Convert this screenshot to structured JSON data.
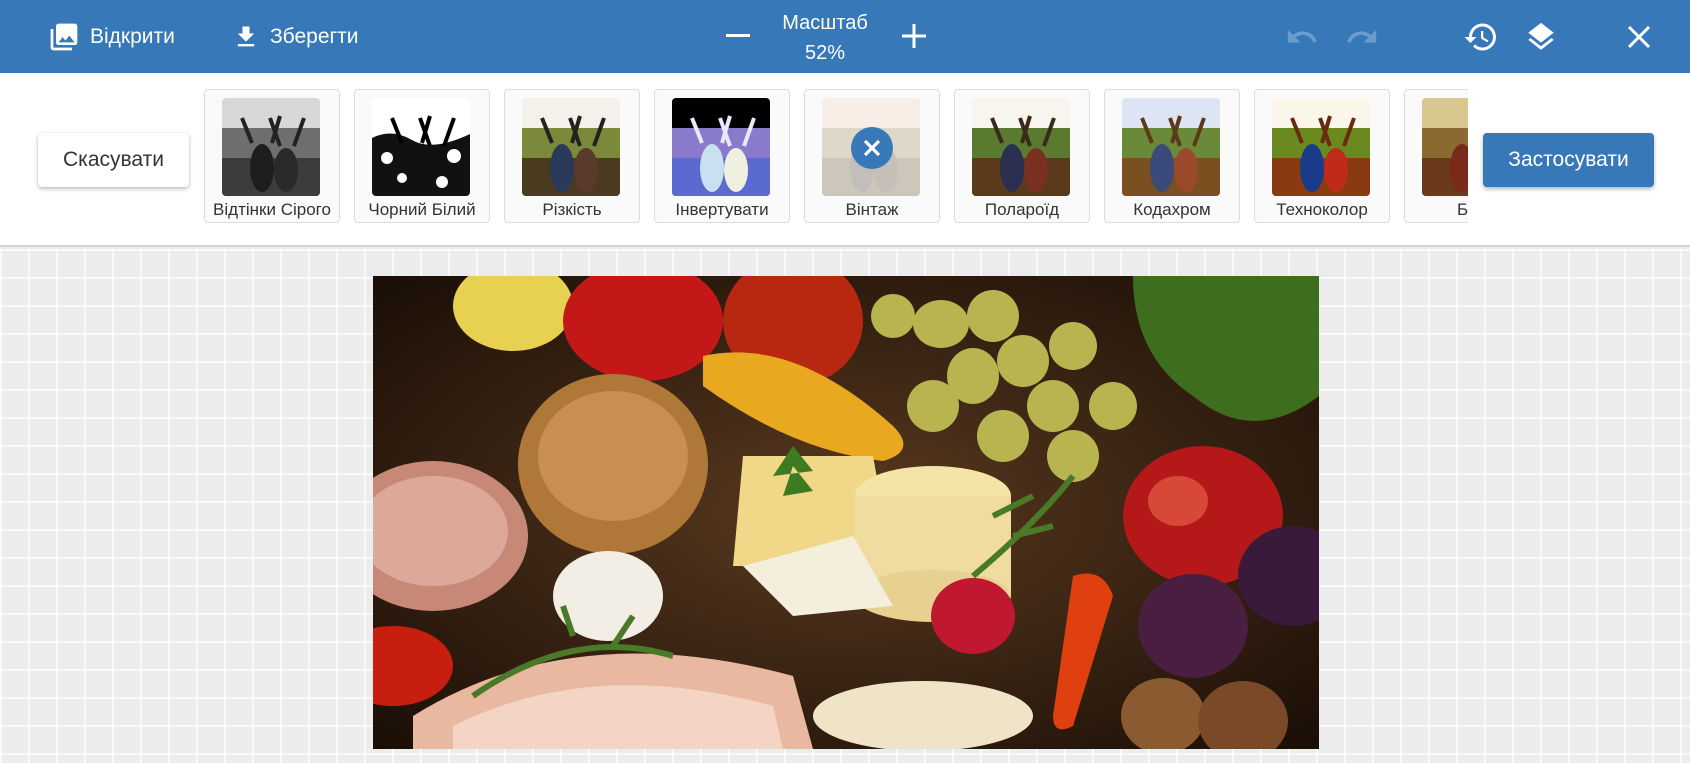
{
  "toolbar": {
    "open_label": "Відкрити",
    "save_label": "Зберегти",
    "zoom_label": "Масштаб",
    "zoom_value": "52%",
    "open_icon": "image-gallery-icon",
    "save_icon": "download-icon",
    "zoom_out_icon": "minus-icon",
    "zoom_in_icon": "plus-icon",
    "undo_icon": "undo-icon",
    "redo_icon": "redo-icon",
    "history_icon": "history-icon",
    "layers_icon": "layers-icon",
    "close_icon": "close-icon",
    "undo_enabled": false,
    "redo_enabled": false
  },
  "filters_panel": {
    "cancel_label": "Скасувати",
    "apply_label": "Застосувати",
    "selected": "Вінтаж",
    "items": [
      {
        "label": "Відтінки Сірого"
      },
      {
        "label": "Чорний Білий"
      },
      {
        "label": "Різкість"
      },
      {
        "label": "Інвертувати"
      },
      {
        "label": "Вінтаж"
      },
      {
        "label": "Полароїд"
      },
      {
        "label": "Кодахром"
      },
      {
        "label": "Техноколор"
      },
      {
        "label": "Бра"
      }
    ]
  },
  "colors": {
    "primary": "#3779b8",
    "canvas_bg": "#ececec"
  }
}
